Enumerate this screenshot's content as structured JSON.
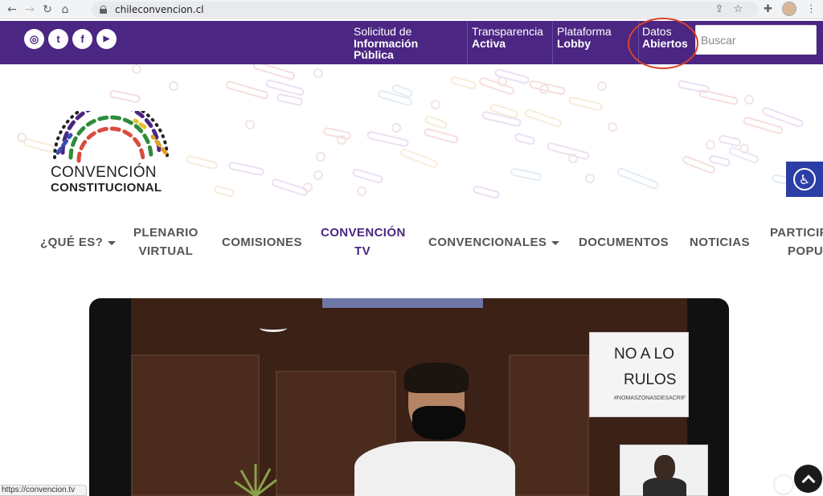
{
  "browser": {
    "url": "chileconvencion.cl",
    "back_icon": "arrow-left",
    "forward_icon": "arrow-right",
    "reload_icon": "reload",
    "home_icon": "home",
    "share_icon": "share",
    "star_icon": "star",
    "extensions_icon": "puzzle",
    "menu_icon": "more-vertical"
  },
  "topbar": {
    "social": [
      {
        "name": "instagram",
        "glyph": "◎"
      },
      {
        "name": "twitter",
        "glyph": "t"
      },
      {
        "name": "facebook",
        "glyph": "f"
      },
      {
        "name": "youtube",
        "glyph": "▶"
      }
    ],
    "links": [
      {
        "line1": "Solicitud de",
        "line2": "Información",
        "line3": "Pública"
      },
      {
        "line1": "Transparencia",
        "line2": "Activa"
      },
      {
        "line1": "Plataforma",
        "line2": "Lobby"
      },
      {
        "line1": "Datos",
        "line2": "Abiertos"
      }
    ],
    "search_placeholder": "Buscar",
    "background": "#4b2682"
  },
  "logo": {
    "line1": "CONVENCIÓN",
    "line2": "CONSTITUCIONAL"
  },
  "nav": {
    "items": [
      {
        "label": "¿QUÉ ES?",
        "dropdown": true
      },
      {
        "label": "PLENARIO",
        "label2": "VIRTUAL"
      },
      {
        "label": "COMISIONES"
      },
      {
        "label": "CONVENCIÓN",
        "label2": "TV",
        "active": true
      },
      {
        "label": "CONVENCIONALES",
        "dropdown": true
      },
      {
        "label": "DOCUMENTOS"
      },
      {
        "label": "NOTICIAS"
      },
      {
        "label": "PARTICIP",
        "label2": "POPUL"
      }
    ]
  },
  "video": {
    "sign_line1": "NO A LO",
    "sign_line2": "RULOS",
    "sign_line3": "#NOMASZONASDESACRIF"
  },
  "status": {
    "url": "https://convencion.tv"
  },
  "colors": {
    "accent": "#4b2682",
    "highlight_circle": "#d9432b",
    "accessibility": "#2b3ea6"
  }
}
